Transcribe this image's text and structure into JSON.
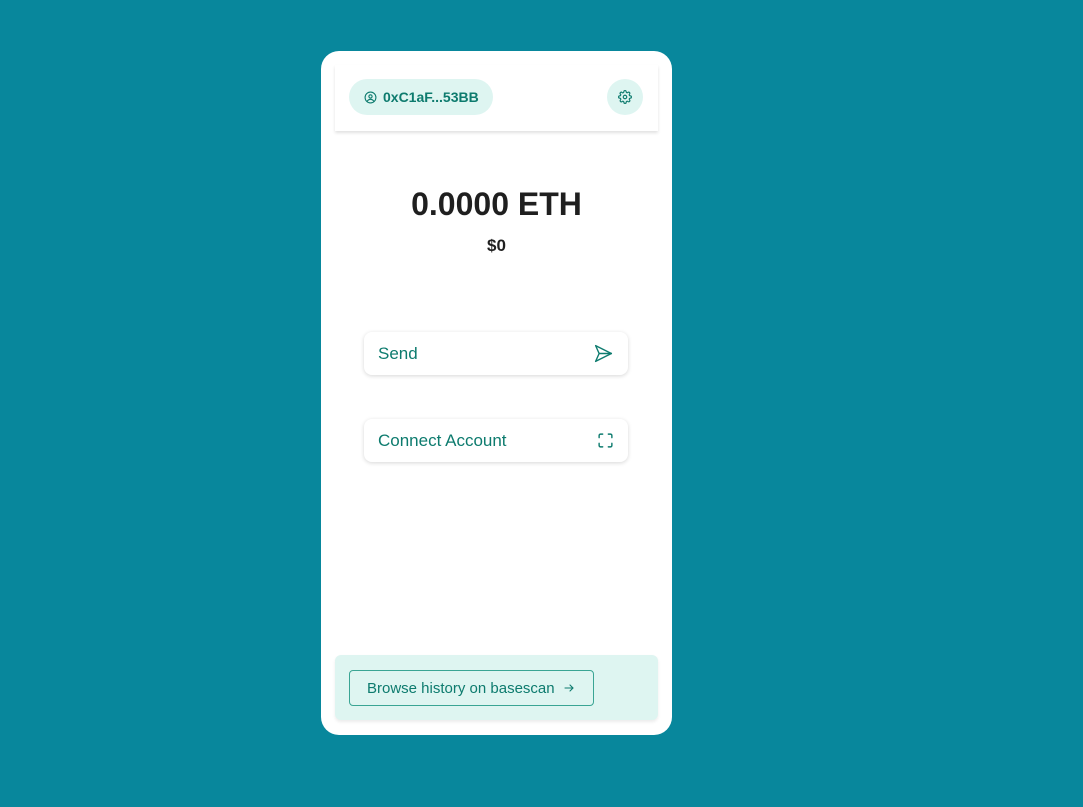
{
  "header": {
    "account_label": "0xC1aF...53BB",
    "account_icon": "user-circle-icon",
    "settings_icon": "gear-icon"
  },
  "balance": {
    "amount": "0.0000 ETH",
    "fiat": "$0"
  },
  "actions": [
    {
      "label": "Send",
      "icon": "send-arrow-icon"
    },
    {
      "label": "Connect Account",
      "icon": "scan-frame-icon"
    }
  ],
  "footer": {
    "history_label": "Browse history on basescan",
    "history_icon": "arrow-right-icon"
  },
  "colors": {
    "background": "#08879c",
    "accent": "#0d7b6e",
    "accent_soft": "#def5f1",
    "text_dark": "#1f1f1f"
  }
}
